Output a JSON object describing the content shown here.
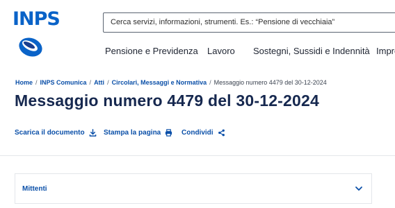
{
  "logo": {
    "text": "INPS"
  },
  "search": {
    "text": "Cerca servizi, informazioni, strumenti. Es.: “Pensione di vecchiaia”"
  },
  "nav": {
    "items": [
      {
        "label": "Pensione e Previdenza"
      },
      {
        "label": "Lavoro"
      },
      {
        "label": "Sostegni, Sussidi e Indennità"
      },
      {
        "label": "Impre"
      }
    ]
  },
  "breadcrumb": {
    "items": [
      {
        "label": "Home"
      },
      {
        "label": "INPS Comunica"
      },
      {
        "label": "Atti"
      },
      {
        "label": "Circolari, Messaggi e Normativa"
      }
    ],
    "separator": "/",
    "current": "Messaggio numero 4479 del 30-12-2024"
  },
  "title": "Messaggio numero 4479 del 30-12-2024",
  "actions": {
    "download": "Scarica il documento",
    "print": "Stampa la pagina",
    "share": "Condividi"
  },
  "accordion": {
    "label": "Mittenti",
    "icon": "chevron-down-icon"
  },
  "colors": {
    "brand": "#0a63c8",
    "link": "#0a4fa8",
    "title": "#16284f"
  }
}
